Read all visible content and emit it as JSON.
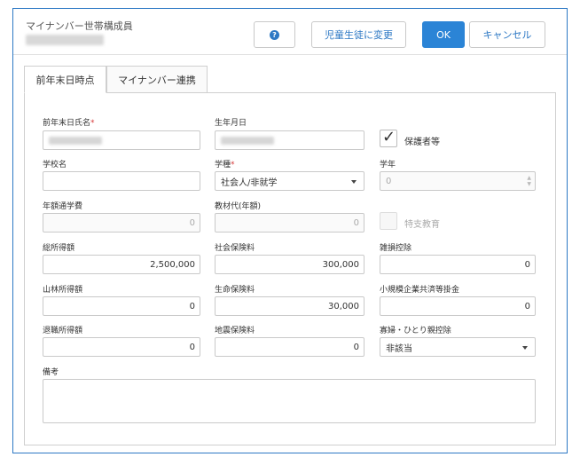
{
  "header": {
    "title": "マイナンバー世帯構成員",
    "help_icon": "?",
    "change_button": "児童生徒に変更",
    "ok_button": "OK",
    "cancel_button": "キャンセル"
  },
  "tabs": [
    {
      "label": "前年末日時点",
      "active": true
    },
    {
      "label": "マイナンバー連携",
      "active": false
    }
  ],
  "form": {
    "name": {
      "label": "前年末日氏名",
      "required_mark": "*"
    },
    "birth": {
      "label": "生年月日"
    },
    "guardian": {
      "label": "保護者等",
      "checked": true
    },
    "school": {
      "label": "学校名",
      "value": ""
    },
    "school_type": {
      "label": "学種",
      "required_mark": "*",
      "value": "社会人/非就学"
    },
    "grade": {
      "label": "学年",
      "value": "0"
    },
    "tuition": {
      "label": "年額通学費",
      "value": "0"
    },
    "textbook": {
      "label": "教材代(年額)",
      "value": "0"
    },
    "special": {
      "label": "特支教育",
      "checked": false
    },
    "total_income": {
      "label": "総所得額",
      "value": "2,500,000"
    },
    "social_insurance": {
      "label": "社会保険料",
      "value": "300,000"
    },
    "casualty": {
      "label": "雑損控除",
      "value": "0"
    },
    "forest_income": {
      "label": "山林所得額",
      "value": "0"
    },
    "life_insurance": {
      "label": "生命保険料",
      "value": "30,000"
    },
    "small_business": {
      "label": "小規模企業共済等掛金",
      "value": "0"
    },
    "retirement_income": {
      "label": "退職所得額",
      "value": "0"
    },
    "earthquake": {
      "label": "地震保険料",
      "value": "0"
    },
    "widow": {
      "label": "寡婦・ひとり親控除",
      "value": "非該当"
    },
    "remarks": {
      "label": "備考",
      "value": ""
    }
  },
  "colors": {
    "accent": "#2b84d6",
    "border": "#2d78c4",
    "required": "#d63b3b"
  }
}
